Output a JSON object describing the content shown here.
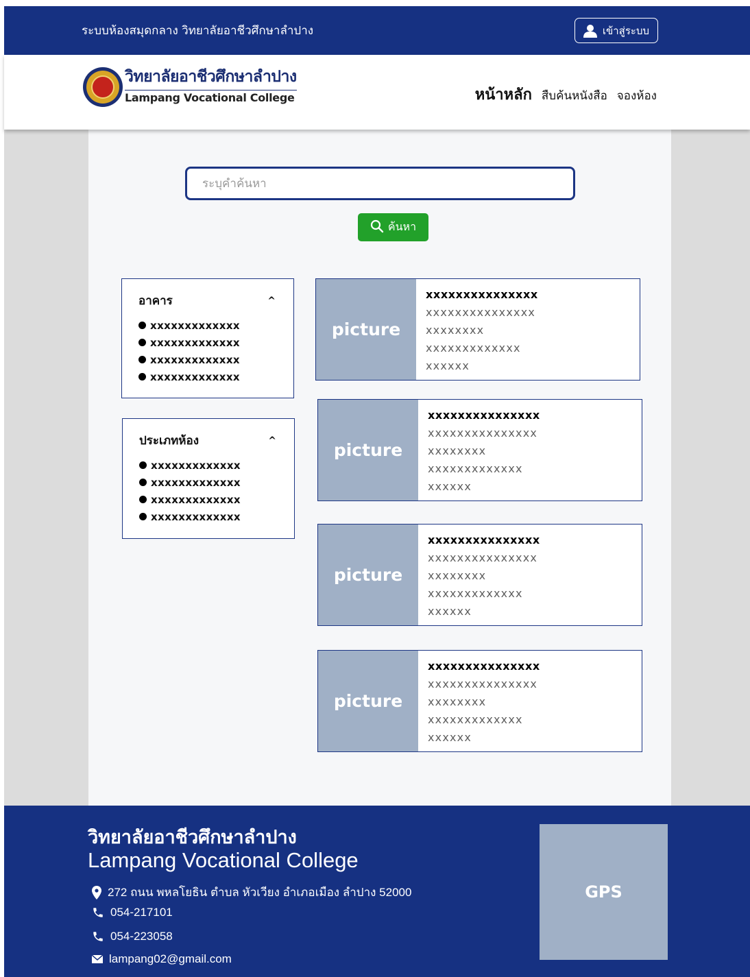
{
  "topbar": {
    "title": "ระบบห้องสมุดกลาง วิทยาลัยอาชีวศึกษาลำปาง",
    "login_label": "เข้าสู่ระบบ",
    "login_icon": "user-icon"
  },
  "header": {
    "logo_th": "วิทยาลัยอาชีวศึกษาลำปาง",
    "logo_en": "Lampang Vocational College",
    "nav": {
      "home": "หน้าหลัก",
      "search_books": "สืบค้นหนังสือ",
      "book_room": "จองห้อง"
    }
  },
  "search": {
    "placeholder": "ระบุคำค้นหา",
    "value": "",
    "button_label": "ค้นหา",
    "button_icon": "search-icon"
  },
  "filters": {
    "building": {
      "title": "อาคาร",
      "toggle": "^",
      "items": [
        "xxxxxxxxxxxxx",
        "xxxxxxxxxxxxx",
        "xxxxxxxxxxxxx",
        "xxxxxxxxxxxxx"
      ]
    },
    "room_type": {
      "title": "ประเภทห้อง",
      "toggle": "^",
      "items": [
        "xxxxxxxxxxxxx",
        "xxxxxxxxxxxxx",
        "xxxxxxxxxxxxx",
        "xxxxxxxxxxxxx"
      ]
    }
  },
  "results": [
    {
      "picture": "picture",
      "lines": [
        "xxxxxxxxxxxxxxx",
        "xxxxxxxxxxxxxxx",
        "xxxxxxxx",
        "xxxxxxxxxxxxx",
        "xxxxxx"
      ]
    },
    {
      "picture": "picture",
      "lines": [
        "xxxxxxxxxxxxxxx",
        "xxxxxxxxxxxxxxx",
        "xxxxxxxx",
        "xxxxxxxxxxxxx",
        "xxxxxx"
      ]
    },
    {
      "picture": "picture",
      "lines": [
        "xxxxxxxxxxxxxxx",
        "xxxxxxxxxxxxxxx",
        "xxxxxxxx",
        "xxxxxxxxxxxxx",
        "xxxxxx"
      ]
    },
    {
      "picture": "picture",
      "lines": [
        "xxxxxxxxxxxxxxx",
        "xxxxxxxxxxxxxxx",
        "xxxxxxxx",
        "xxxxxxxxxxxxx",
        "xxxxxx"
      ]
    }
  ],
  "footer": {
    "name_th": "วิทยาลัยอาชีวศึกษาลำปาง",
    "name_en": "Lampang Vocational College",
    "address": "272 ถนน พหลโยธิน ตำบล หัวเวียง อำเภอเมือง ลำปาง 52000",
    "phone1": "054-217101",
    "phone2": "054-223058",
    "email": "lampang02@gmail.com",
    "gps_label": "GPS"
  },
  "colors": {
    "primary": "#163182",
    "accent_green": "#22a12a",
    "placeholder_gray": "#a0b0c6",
    "page_bg": "#dcdcdc",
    "content_bg": "#f6f7f9"
  }
}
